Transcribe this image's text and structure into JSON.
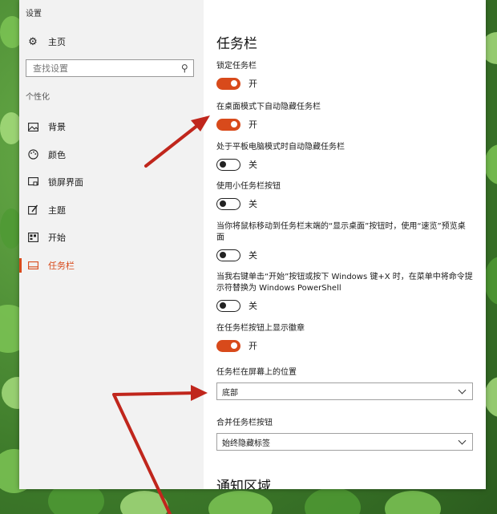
{
  "window": {
    "title": "设置"
  },
  "sidebar": {
    "home_label": "主页",
    "search_placeholder": "查找设置",
    "section_label": "个性化",
    "items": [
      {
        "label": "背景",
        "icon": "image-icon"
      },
      {
        "label": "颜色",
        "icon": "palette-icon"
      },
      {
        "label": "锁屏界面",
        "icon": "lock-screen-icon"
      },
      {
        "label": "主题",
        "icon": "theme-icon"
      },
      {
        "label": "开始",
        "icon": "start-icon"
      },
      {
        "label": "任务栏",
        "icon": "taskbar-icon",
        "active": true
      }
    ]
  },
  "main": {
    "title": "任务栏",
    "settings": [
      {
        "label": "锁定任务栏",
        "state": "开",
        "on": true
      },
      {
        "label": "在桌面模式下自动隐藏任务栏",
        "state": "开",
        "on": true
      },
      {
        "label": "处于平板电脑模式时自动隐藏任务栏",
        "state": "关",
        "on": false
      },
      {
        "label": "使用小任务栏按钮",
        "state": "关",
        "on": false
      },
      {
        "label": "当你将鼠标移动到任务栏末端的“显示桌面”按钮时，使用“速览”预览桌面",
        "state": "关",
        "on": false
      },
      {
        "label": "当我右键单击“开始”按钮或按下 Windows 键+X 时，在菜单中将命令提示符替换为 Windows PowerShell",
        "state": "关",
        "on": false
      },
      {
        "label": "在任务栏按钮上显示徽章",
        "state": "开",
        "on": true
      }
    ],
    "position_label": "任务栏在屏幕上的位置",
    "position_value": "底部",
    "combine_label": "合并任务栏按钮",
    "combine_value": "始终隐藏标签",
    "notify_title": "通知区域"
  },
  "colors": {
    "accent": "#d84a1b",
    "annotation_arrow": "#c0261c"
  }
}
